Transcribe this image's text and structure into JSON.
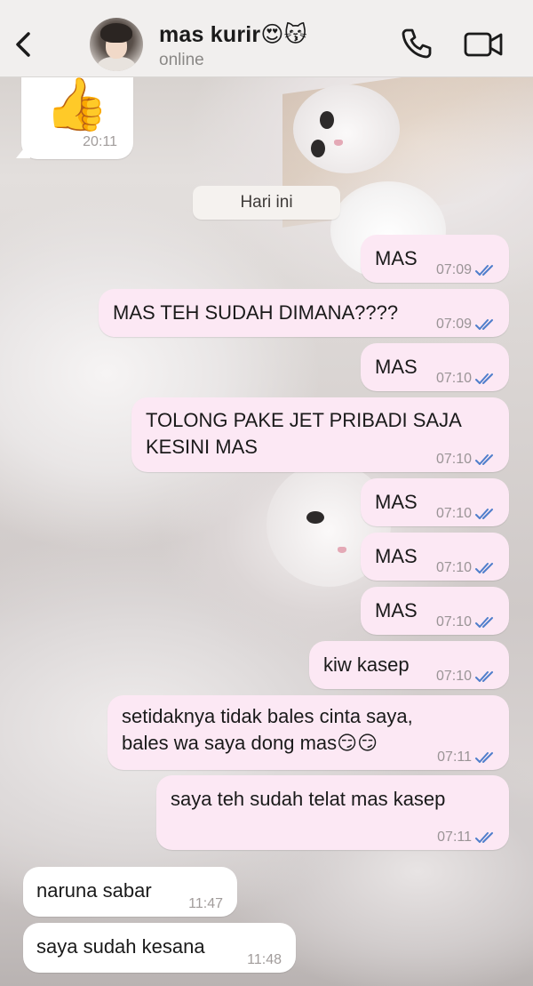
{
  "header": {
    "contact_name": "mas kurir😍😽",
    "status": "online"
  },
  "date_separator": "Hari ini",
  "messages": [
    {
      "dir": "in",
      "text": "👍",
      "time": "20:11"
    },
    {
      "dir": "out",
      "text": "MAS",
      "time": "07:09",
      "read": true
    },
    {
      "dir": "out",
      "text": "MAS TEH SUDAH DIMANA????",
      "time": "07:09",
      "read": true
    },
    {
      "dir": "out",
      "text": "MAS",
      "time": "07:10",
      "read": true
    },
    {
      "dir": "out",
      "text": "TOLONG PAKE JET PRIBADI SAJA\nKESINI MAS",
      "time": "07:10",
      "read": true
    },
    {
      "dir": "out",
      "text": "MAS",
      "time": "07:10",
      "read": true
    },
    {
      "dir": "out",
      "text": "MAS",
      "time": "07:10",
      "read": true
    },
    {
      "dir": "out",
      "text": "MAS",
      "time": "07:10",
      "read": true
    },
    {
      "dir": "out",
      "text": "kiw kasep",
      "time": "07:10",
      "read": true
    },
    {
      "dir": "out",
      "text": "setidaknya tidak bales cinta saya,\nbales wa saya dong mas😏😏",
      "time": "07:11",
      "read": true
    },
    {
      "dir": "out",
      "text": "saya teh sudah telat mas kasep",
      "time": "07:11",
      "read": true
    },
    {
      "dir": "in",
      "text": "naruna sabar",
      "time": "11:47"
    },
    {
      "dir": "in",
      "text": "saya sudah kesana",
      "time": "11:48"
    }
  ],
  "colors": {
    "outgoing_bubble": "#fce8f4",
    "incoming_bubble": "#ffffff",
    "header_bg": "#f1efee",
    "read_tick": "#4f7ecb"
  },
  "icons": [
    "back-chevron-icon",
    "phone-icon",
    "video-camera-icon",
    "double-check-icon"
  ]
}
